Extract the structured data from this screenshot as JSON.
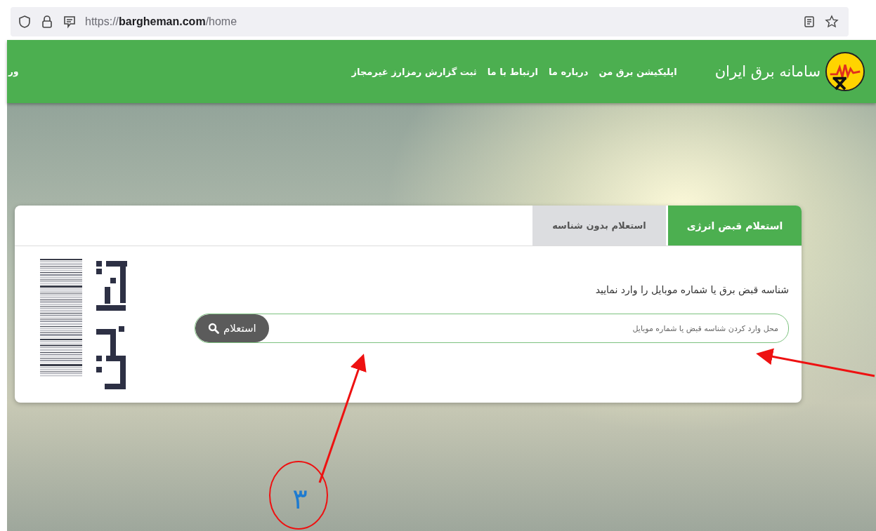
{
  "browser": {
    "url": "https://**bargheman.com**/home"
  },
  "header": {
    "site_title": "سامانه برق ایران",
    "nav": [
      "اپلیکیشن برق من",
      "درباره ما",
      "ارتباط با ما",
      "ثبت گزارش رمزارز غیرمجاز"
    ],
    "cut_item": "ور"
  },
  "card": {
    "tabs": [
      {
        "label": "استعلام قبض انرژی",
        "selected": true
      },
      {
        "label": "استعلام بدون شناسه",
        "selected": false
      }
    ],
    "prompt": "شناسه قبض برق یا شماره موبایل را وارد نمایید",
    "search": {
      "placeholder": "محل وارد کردن شناسه قبض یا شماره موبایل",
      "button": "استعلام"
    }
  },
  "annotation": {
    "label": "۳"
  }
}
